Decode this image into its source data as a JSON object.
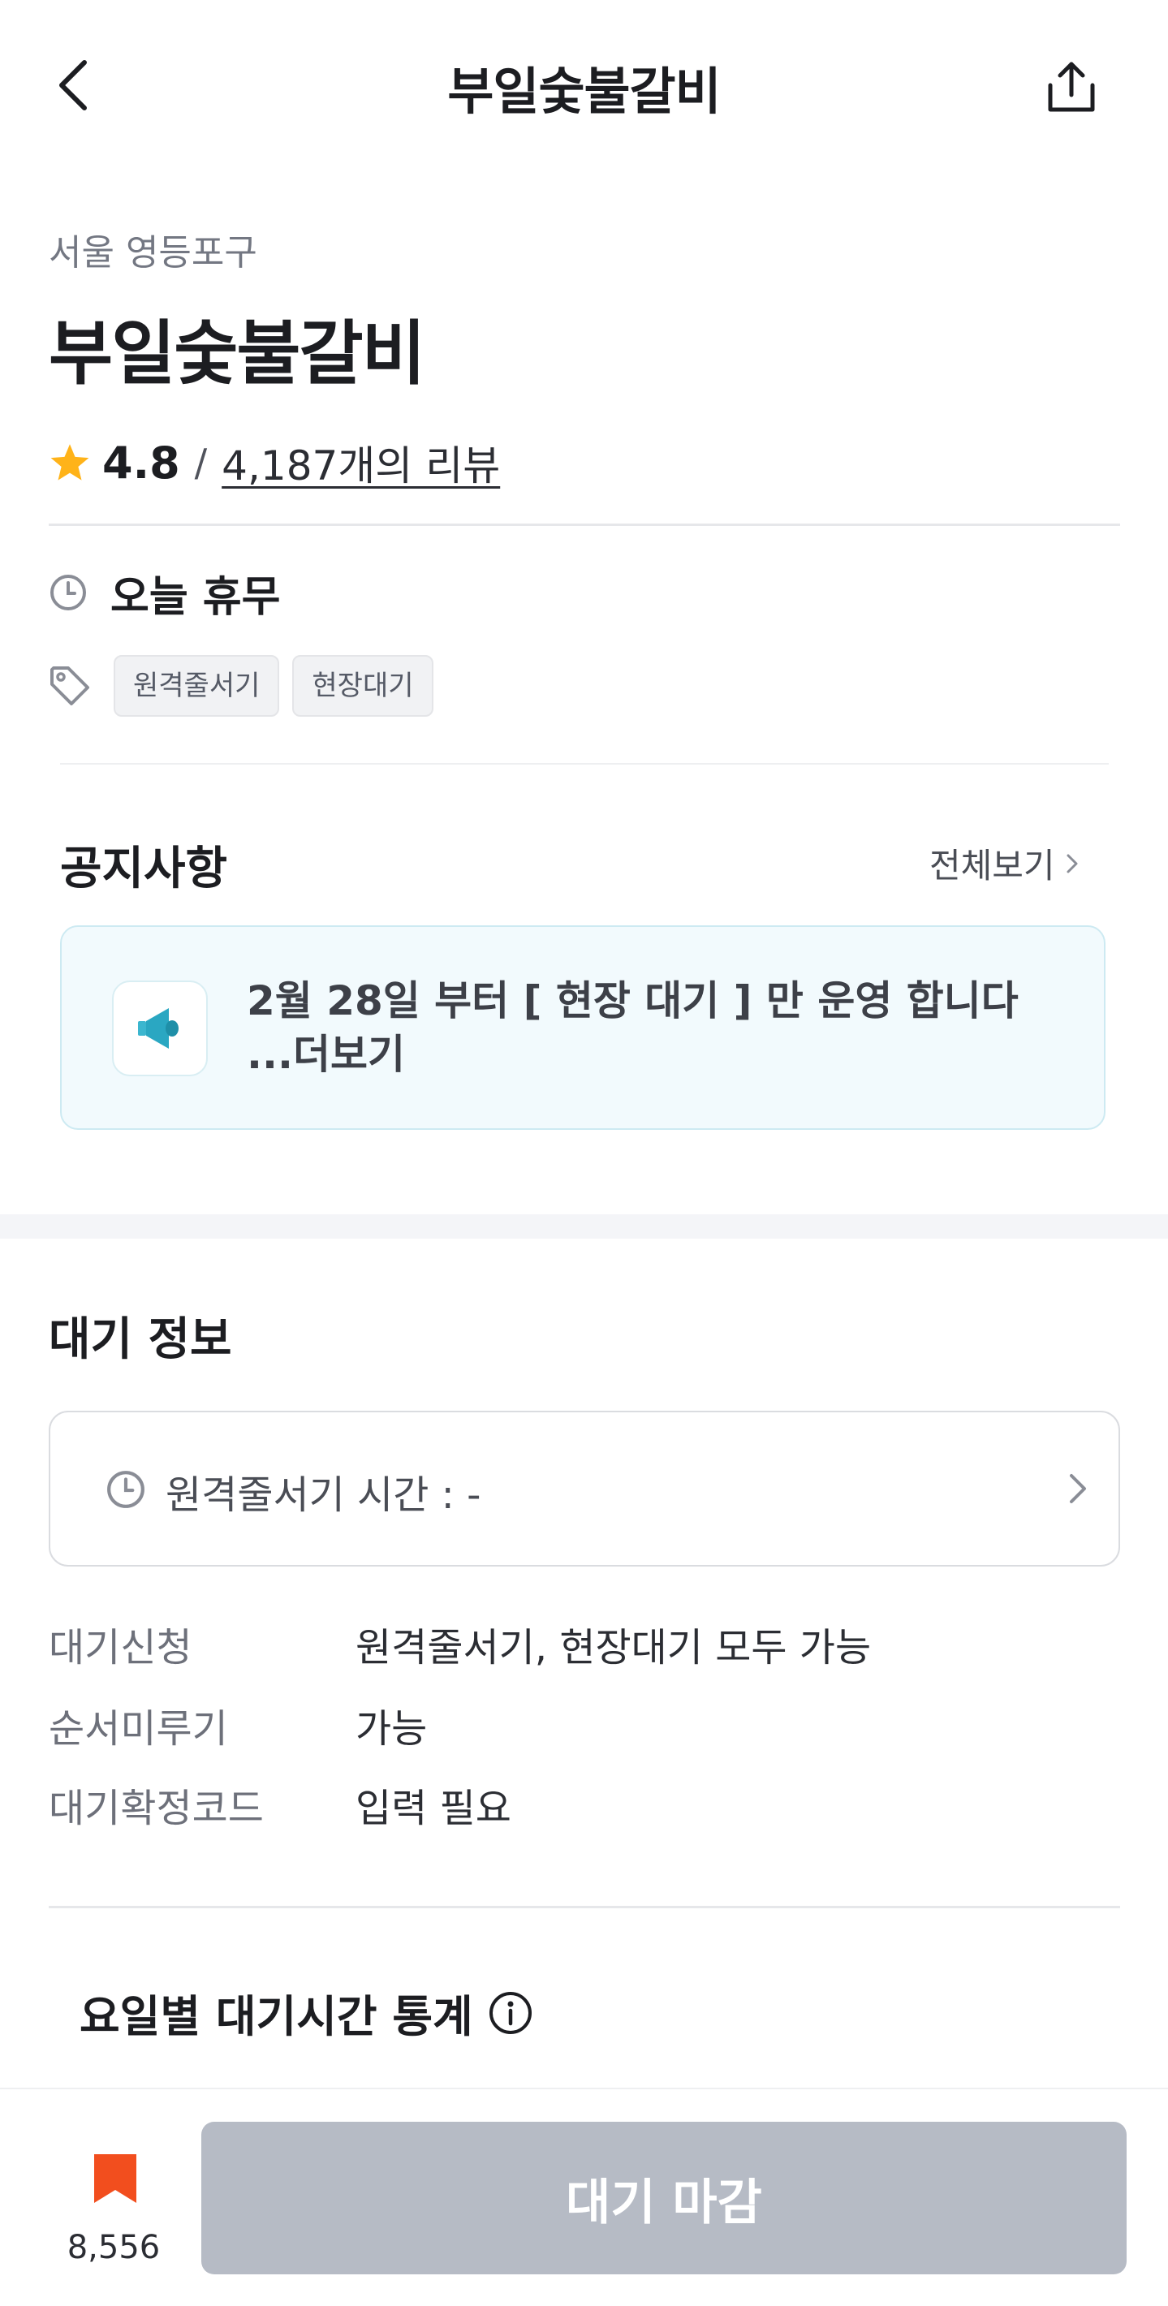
{
  "header": {
    "title": "부일숯불갈비",
    "back_icon": "chevron-left-icon",
    "share_icon": "share-icon"
  },
  "store": {
    "location": "서울 영등포구",
    "name": "부일숯불갈비",
    "rating": "4.8",
    "rating_separator": "/",
    "review_link": "4,187개의 리뷰",
    "star_color": "#FFB319",
    "hours_status": "오늘 휴무",
    "tags": [
      "원격줄서기",
      "현장대기"
    ]
  },
  "notice": {
    "title": "공지사항",
    "see_all": "전체보기",
    "text": "2월 28일 부터 [ 현장 대기 ] 만 운영 합니다",
    "more": "...더보기",
    "icon": "megaphone-icon",
    "accent_color": "#3BB6CF"
  },
  "wait_info": {
    "title": "대기 정보",
    "remote_time_label": "원격줄서기 시간 : -",
    "rows": [
      {
        "label": "대기신청",
        "value": "원격줄서기, 현장대기 모두 가능"
      },
      {
        "label": "순서미루기",
        "value": "가능"
      },
      {
        "label": "대기확정코드",
        "value": "입력 필요"
      }
    ]
  },
  "stats": {
    "title": "요일별 대기시간 통계"
  },
  "bottom_bar": {
    "bookmark_count": "8,556",
    "bookmark_color": "#F24E1E",
    "wait_button_label": "대기 마감"
  }
}
